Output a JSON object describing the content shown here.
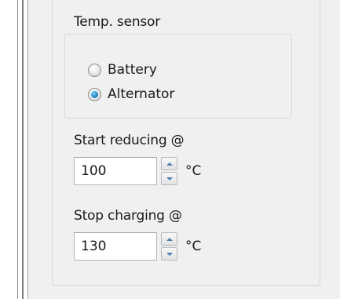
{
  "sensor_group": {
    "title": "Temp. sensor",
    "options": [
      {
        "label": "Battery",
        "checked": false
      },
      {
        "label": "Alternator",
        "checked": true
      }
    ]
  },
  "start_reducing": {
    "label": "Start reducing @",
    "value": "100",
    "unit": "°C"
  },
  "stop_charging": {
    "label": "Stop charging @",
    "value": "130",
    "unit": "°C"
  },
  "colors": {
    "panel_bg": "#f0f0f0",
    "radio_accent": "#2a8cc8",
    "spinner_arrow": "#4a7fb5"
  }
}
